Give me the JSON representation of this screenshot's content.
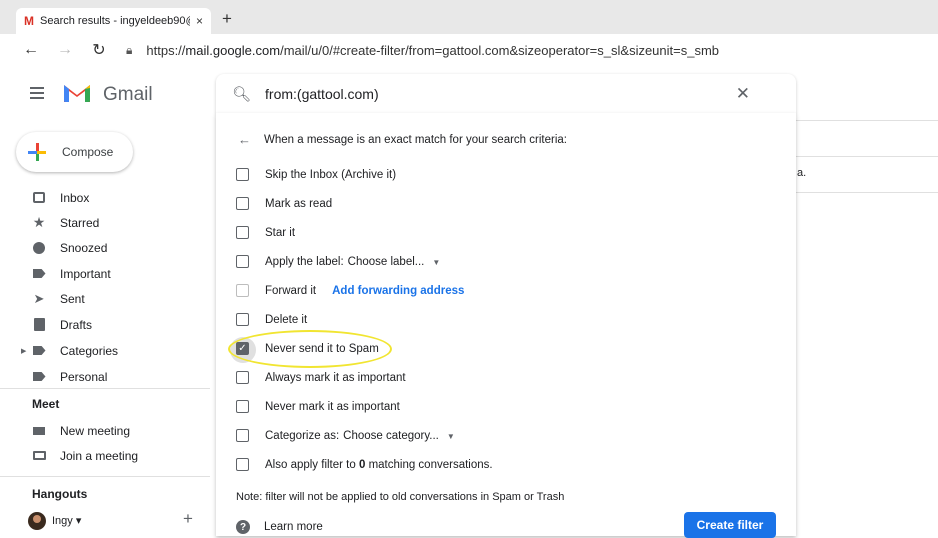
{
  "browser": {
    "tab_title": "Search results - ingyeldeeb90@",
    "tab_close": "×",
    "new_tab": "+",
    "back": "←",
    "forward": "→",
    "reload": "↻",
    "url_prefix": "https://",
    "url_host": "mail.google.com",
    "url_path": "/mail/u/0/#create-filter/from=gattool.com&sizeoperator=s_sl&sizeunit=s_smb"
  },
  "header": {
    "app_name": "Gmail",
    "search_value": "from:(gattool.com)",
    "search_close": "✕"
  },
  "sidebar": {
    "compose_label": "Compose",
    "items": [
      {
        "label": "Inbox",
        "icon": "inbox-icon"
      },
      {
        "label": "Starred",
        "icon": "star-icon"
      },
      {
        "label": "Snoozed",
        "icon": "clock-icon"
      },
      {
        "label": "Important",
        "icon": "important-icon"
      },
      {
        "label": "Sent",
        "icon": "send-icon"
      },
      {
        "label": "Drafts",
        "icon": "draft-icon"
      },
      {
        "label": "Categories",
        "icon": "label-icon"
      },
      {
        "label": "Personal",
        "icon": "label-icon"
      }
    ],
    "meet_heading": "Meet",
    "meet_items": [
      {
        "label": "New meeting",
        "icon": "camera-icon"
      },
      {
        "label": "Join a meeting",
        "icon": "keyboard-icon"
      }
    ],
    "hangouts_heading": "Hangouts",
    "hangouts_user": "Ingy ▾",
    "hangouts_add": "+"
  },
  "main": {
    "partial_text": "a."
  },
  "filter": {
    "heading": "When a message is an exact match for your search criteria:",
    "options": {
      "skip_inbox": "Skip the Inbox (Archive it)",
      "mark_read": "Mark as read",
      "star_it": "Star it",
      "apply_label": "Apply the label:",
      "label_dropdown": "Choose label...",
      "forward_it": "Forward it",
      "add_forwarding": "Add forwarding address",
      "delete_it": "Delete it",
      "never_spam": "Never send it to Spam",
      "always_important": "Always mark it as important",
      "never_important": "Never mark it as important",
      "categorize_as": "Categorize as:",
      "category_dropdown": "Choose category...",
      "also_apply_prefix": "Also apply filter to ",
      "also_apply_count": "0",
      "also_apply_suffix": " matching conversations."
    },
    "note": "Note: filter will not be applied to old conversations in Spam or Trash",
    "learn_more": "Learn more",
    "create_button": "Create filter",
    "checked_option": "never_spam"
  },
  "colors": {
    "accent": "#1a73e8",
    "highlight": "#f1e531"
  }
}
